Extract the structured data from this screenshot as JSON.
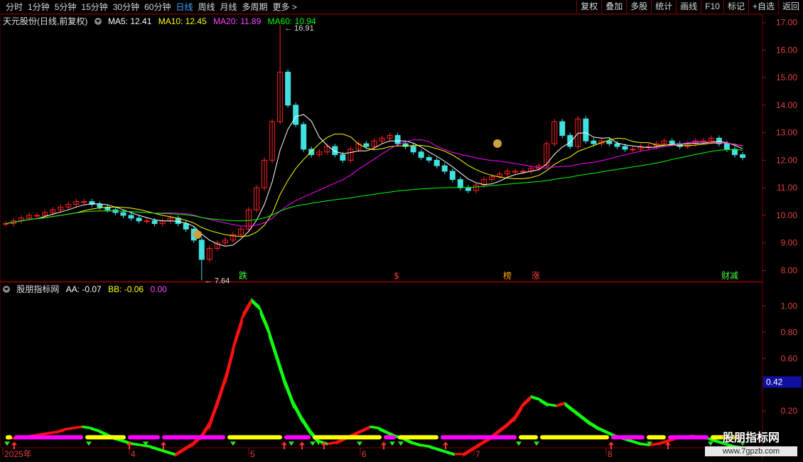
{
  "toolbar": {
    "periods": [
      "分时",
      "1分钟",
      "5分钟",
      "15分钟",
      "30分钟",
      "60分钟",
      "日线",
      "周线",
      "月线",
      "多周期",
      "更多 >"
    ],
    "active_period": "日线",
    "right_buttons": [
      "复权",
      "叠加",
      "多股",
      "统计",
      "画线",
      "F10",
      "标记",
      "+自选",
      "返回"
    ]
  },
  "main_legend": {
    "title": "天元股份(日线,前复权)",
    "ma5": "MA5: 12.41",
    "ma10": "MA10: 12.45",
    "ma20": "MA20: 11.89",
    "ma60": "MA60: 10.94",
    "colors": {
      "ma5": "#ffffff",
      "ma10": "#ffff00",
      "ma20": "#ff00ff",
      "ma60": "#00ff00"
    }
  },
  "indicator_legend": {
    "title": "股朋指标网",
    "aa": "AA: -0.07",
    "bb": "BB: -0.06",
    "cc": "0.00"
  },
  "price_axis": [
    "17.00",
    "16.00",
    "15.00",
    "14.00",
    "13.00",
    "12.00",
    "11.00",
    "10.00",
    "9.00",
    "8.00"
  ],
  "indicator_axis": [
    "1.00",
    "0.80",
    "0.60",
    "0.40",
    "0.20"
  ],
  "indicator_current": "0.42",
  "date_axis": [
    "2025年",
    "4",
    "5",
    "6",
    "7",
    "8"
  ],
  "annotations": {
    "high": "16.91",
    "low": "7.64",
    "markers": [
      "跌",
      "$",
      "榜",
      "涨",
      "财减"
    ]
  },
  "watermark": {
    "title": "股朋指标网",
    "url": "www.7gpzb.com"
  },
  "chart_data": {
    "type": "candlestick",
    "ylim": [
      7.6,
      17.3
    ],
    "ma5_last": 12.41,
    "ma10_last": 12.45,
    "ma20_last": 11.89,
    "ma60_last": 10.94,
    "high": 16.91,
    "low": 7.64,
    "closes": [
      9.7,
      9.8,
      9.9,
      10.0,
      10.0,
      10.1,
      10.2,
      10.3,
      10.4,
      10.5,
      10.5,
      10.4,
      10.3,
      10.2,
      10.1,
      10.0,
      9.9,
      9.8,
      9.8,
      9.7,
      9.8,
      9.9,
      9.7,
      9.5,
      9.1,
      8.4,
      8.8,
      9.0,
      9.1,
      9.3,
      9.5,
      10.2,
      11.0,
      12.0,
      13.4,
      15.2,
      14.0,
      13.3,
      12.4,
      12.2,
      12.3,
      12.5,
      12.2,
      12.0,
      12.4,
      12.6,
      12.5,
      12.7,
      12.8,
      12.9,
      12.6,
      12.5,
      12.3,
      12.1,
      12.0,
      11.8,
      11.6,
      11.3,
      11.0,
      10.9,
      11.1,
      11.3,
      11.4,
      11.5,
      11.6,
      11.6,
      11.6,
      11.7,
      11.8,
      12.6,
      13.4,
      12.9,
      12.5,
      13.5,
      12.7,
      12.6,
      12.7,
      12.6,
      12.5,
      12.4,
      12.4,
      12.5,
      12.5,
      12.6,
      12.7,
      12.6,
      12.5,
      12.6,
      12.7,
      12.7,
      12.8,
      12.6,
      12.4,
      12.2,
      12.1
    ],
    "indicator": {
      "ylim": [
        -0.08,
        1.18
      ],
      "aa_last": -0.07,
      "bb_last": -0.06,
      "aa": [
        0.0,
        0.0,
        0.01,
        0.02,
        0.03,
        0.04,
        0.05,
        0.07,
        0.08,
        0.09,
        0.08,
        0.06,
        0.03,
        0.0,
        -0.02,
        -0.04,
        -0.05,
        -0.06,
        -0.08,
        -0.1,
        -0.12,
        -0.08,
        -0.04,
        0.02,
        0.12,
        0.3,
        0.5,
        0.75,
        0.95,
        1.06,
        1.0,
        0.85,
        0.65,
        0.45,
        0.28,
        0.16,
        0.06,
        -0.02,
        -0.04,
        -0.03,
        0.0,
        0.03,
        0.06,
        0.09,
        0.08,
        0.05,
        0.02,
        0.0,
        -0.03,
        -0.05,
        -0.06,
        -0.08,
        -0.1,
        -0.12,
        -0.12,
        -0.08,
        -0.04,
        0.0,
        0.05,
        0.1,
        0.16,
        0.26,
        0.32,
        0.3,
        0.26,
        0.25,
        0.27,
        0.22,
        0.17,
        0.12,
        0.08,
        0.05,
        0.02,
        0.0,
        -0.02,
        -0.04,
        -0.05,
        -0.04,
        -0.02,
        0.0,
        0.01,
        0.02,
        0.01,
        0.0,
        -0.02,
        -0.04,
        -0.06,
        -0.07
      ]
    }
  }
}
